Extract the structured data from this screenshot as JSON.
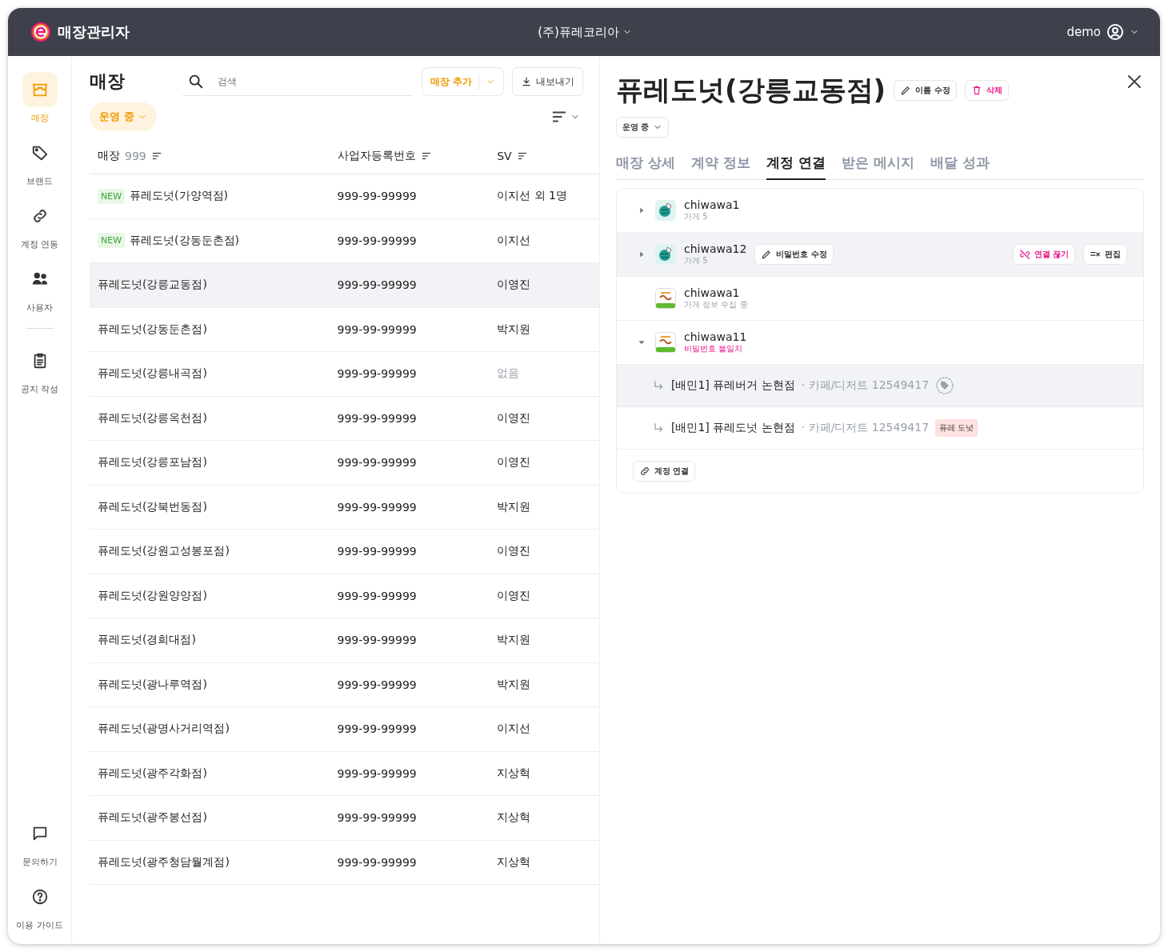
{
  "header": {
    "app_title": "매장관리자",
    "company": "(주)퓨레코리아",
    "user": "demo"
  },
  "sidebar": {
    "items": [
      {
        "label": "매장",
        "selected": true
      },
      {
        "label": "브랜드",
        "selected": false
      },
      {
        "label": "계정 연동",
        "selected": false
      },
      {
        "label": "사용자",
        "selected": false
      },
      {
        "label": "공지 작성",
        "selected": false
      }
    ],
    "bottom_items": [
      {
        "label": "문의하기"
      },
      {
        "label": "이용 가이드"
      }
    ]
  },
  "store_list": {
    "title": "매장",
    "search": {
      "placeholder": "검색"
    },
    "add_button": "매장 추가",
    "export_button": "내보내기",
    "filter": "운영 중",
    "columns": [
      {
        "label": "매장",
        "count": "999"
      },
      {
        "label": "사업자등록번호"
      },
      {
        "label": "SV"
      }
    ],
    "rows": [
      {
        "name": "퓨레도넛(가양역점)",
        "new_badge": "NEW",
        "biz_no": "999-99-99999",
        "sv": "이지선 외 1명",
        "sv_muted": false,
        "selected": false
      },
      {
        "name": "퓨레도넛(강동둔촌점)",
        "new_badge": "NEW",
        "biz_no": "999-99-99999",
        "sv": "이지선",
        "sv_muted": false,
        "selected": false
      },
      {
        "name": "퓨레도넛(강릉교동점)",
        "biz_no": "999-99-99999",
        "sv": "이영진",
        "sv_muted": false,
        "selected": true
      },
      {
        "name": "퓨레도넛(강동둔촌점)",
        "biz_no": "999-99-99999",
        "sv": "박지원",
        "sv_muted": false,
        "selected": false
      },
      {
        "name": "퓨레도넛(강릉내곡점)",
        "biz_no": "999-99-99999",
        "sv": "없음",
        "sv_muted": true,
        "selected": false
      },
      {
        "name": "퓨레도넛(강릉옥천점)",
        "biz_no": "999-99-99999",
        "sv": "이영진",
        "sv_muted": false,
        "selected": false
      },
      {
        "name": "퓨레도넛(강릉포남점)",
        "biz_no": "999-99-99999",
        "sv": "이영진",
        "sv_muted": false,
        "selected": false
      },
      {
        "name": "퓨레도넛(강북번동점)",
        "biz_no": "999-99-99999",
        "sv": "박지원",
        "sv_muted": false,
        "selected": false
      },
      {
        "name": "퓨레도넛(강원고성봉포점)",
        "biz_no": "999-99-99999",
        "sv": "이영진",
        "sv_muted": false,
        "selected": false
      },
      {
        "name": "퓨레도넛(강원양양점)",
        "biz_no": "999-99-99999",
        "sv": "이영진",
        "sv_muted": false,
        "selected": false
      },
      {
        "name": "퓨레도넛(경희대점)",
        "biz_no": "999-99-99999",
        "sv": "박지원",
        "sv_muted": false,
        "selected": false
      },
      {
        "name": "퓨레도넛(광나루역점)",
        "biz_no": "999-99-99999",
        "sv": "박지원",
        "sv_muted": false,
        "selected": false
      },
      {
        "name": "퓨레도넛(광명사거리역점)",
        "biz_no": "999-99-99999",
        "sv": "이지선",
        "sv_muted": false,
        "selected": false
      },
      {
        "name": "퓨레도넛(광주각화점)",
        "biz_no": "999-99-99999",
        "sv": "지상혁",
        "sv_muted": false,
        "selected": false
      },
      {
        "name": "퓨레도넛(광주봉선점)",
        "biz_no": "999-99-99999",
        "sv": "지상혁",
        "sv_muted": false,
        "selected": false
      },
      {
        "name": "퓨레도넛(광주청담월계점)",
        "biz_no": "999-99-99999",
        "sv": "지상혁",
        "sv_muted": false,
        "selected": false
      }
    ]
  },
  "detail": {
    "title": "퓨레도넛(강릉교동점)",
    "rename_button": "이름 수정",
    "delete_button": "삭제",
    "status": "운영 중",
    "tabs": [
      {
        "label": "매장 상세",
        "selected": false
      },
      {
        "label": "계약 정보",
        "selected": false
      },
      {
        "label": "계정 연결",
        "selected": true
      },
      {
        "label": "받은 메시지",
        "selected": false
      },
      {
        "label": "배달 성과",
        "selected": false
      }
    ],
    "accounts": [
      {
        "kind": "globe",
        "id": "chiwawa1",
        "subtitle": "가게 5",
        "warning": false,
        "expandable": true,
        "expanded": false,
        "hovered": false
      },
      {
        "kind": "globe",
        "id": "chiwawa12",
        "subtitle": "가게 5",
        "warning": false,
        "expandable": true,
        "expanded": false,
        "hovered": true,
        "password_button": "비밀번호 수정",
        "disconnect_button": "연결 끊기",
        "edit_button": "편집"
      },
      {
        "kind": "eats",
        "id": "chiwawa1",
        "subtitle": "가게 정보 수집 중",
        "warning": false,
        "expandable": false,
        "hovered": false
      },
      {
        "kind": "eats",
        "id": "chiwawa11",
        "subtitle": "비밀번호 불일치",
        "warning": true,
        "expandable": true,
        "expanded": true,
        "hovered": false,
        "children": [
          {
            "name": "[배민1] 퓨레버거 논현점",
            "category": "· 카페/디저트 12549417",
            "hovered": true
          },
          {
            "name": "[배민1] 퓨레도넛 논현점",
            "category": "· 카페/디저트 12549417",
            "tag": "퓨레 도넛",
            "hovered": false
          }
        ]
      }
    ],
    "link_button": "계정 연결"
  }
}
